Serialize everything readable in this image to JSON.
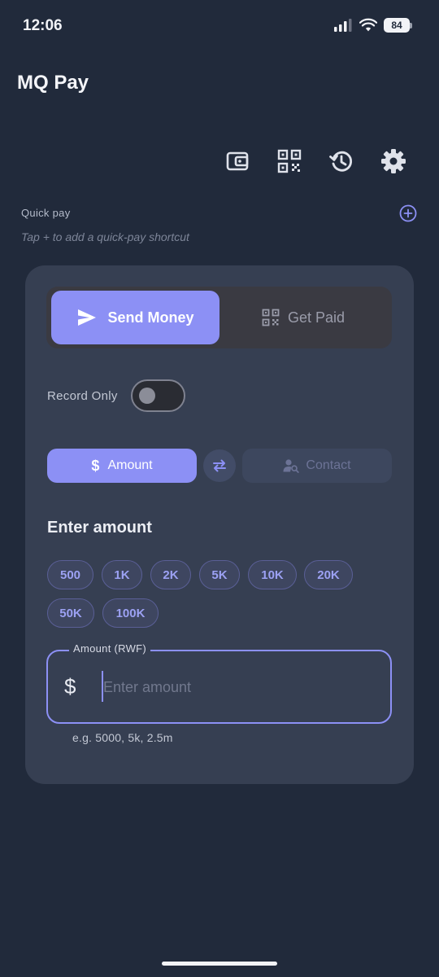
{
  "status_bar": {
    "time": "12:06",
    "battery": "84"
  },
  "app": {
    "title": "MQ Pay"
  },
  "toolbar": {
    "icons": [
      "wallet-icon",
      "qr-code-icon",
      "history-icon",
      "settings-icon"
    ]
  },
  "quick_pay": {
    "label": "Quick pay",
    "hint": "Tap + to add a quick-pay shortcut"
  },
  "mode_switch": {
    "send_label": "Send Money",
    "paid_label": "Get Paid",
    "active": "Send Money"
  },
  "record_only": {
    "label": "Record Only",
    "enabled": false
  },
  "recipient_type": {
    "amount_label": "Amount",
    "contact_label": "Contact",
    "active": "Amount"
  },
  "amount_section": {
    "heading": "Enter amount",
    "presets": [
      "500",
      "1K",
      "2K",
      "5K",
      "10K",
      "20K",
      "50K",
      "100K"
    ],
    "field_label": "Amount (RWF)",
    "currency_symbol": "$",
    "placeholder": "Enter amount",
    "value": "",
    "helper": "e.g. 5000, 5k, 2.5m"
  },
  "colors": {
    "background": "#212a3b",
    "card": "#363f52",
    "accent": "#8c90f5",
    "muted": "#7d8598"
  }
}
